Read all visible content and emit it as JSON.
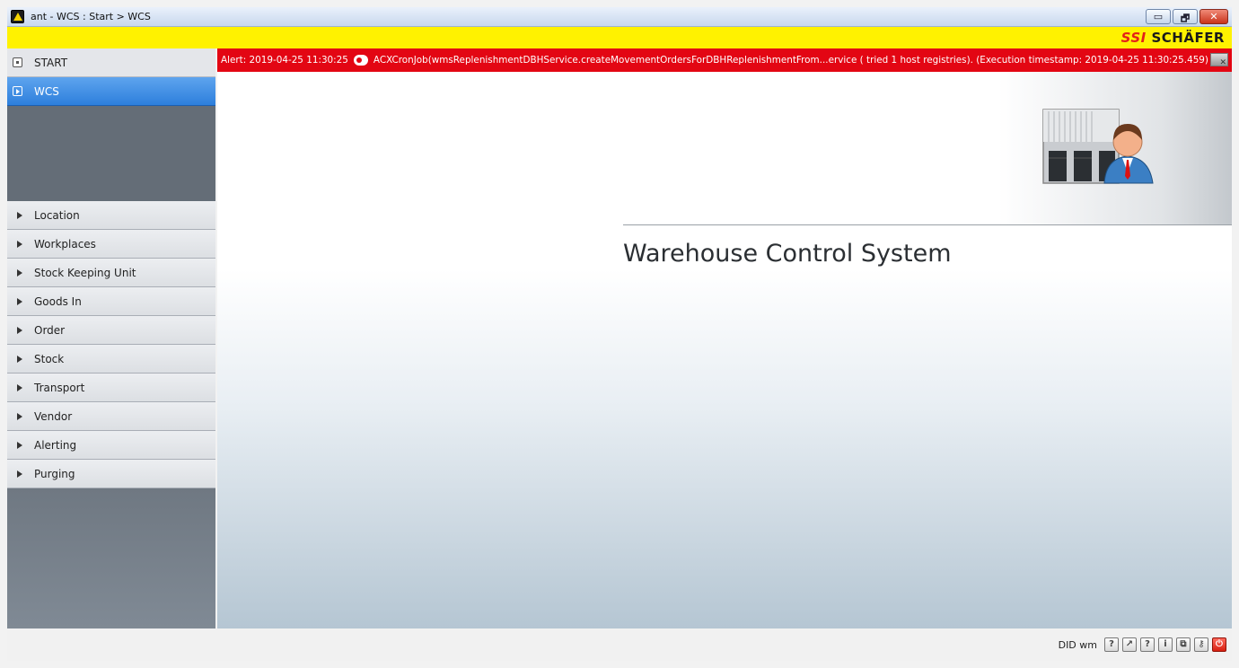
{
  "window": {
    "title": "ant - WCS : Start > WCS",
    "buttons": {
      "minimize": "▭",
      "restore": "🗗",
      "close": "✕"
    }
  },
  "brand": {
    "part1": "SSI",
    "part2": "SCHÄFER",
    "color_red": "#e32119",
    "color_yellow": "#fff200"
  },
  "sidebar": {
    "top": [
      {
        "label": "START",
        "icon": "square-dot-icon",
        "active": false
      },
      {
        "label": "WCS",
        "icon": "play-box-icon",
        "active": true
      }
    ],
    "items": [
      {
        "label": "Location"
      },
      {
        "label": "Workplaces"
      },
      {
        "label": "Stock Keeping Unit"
      },
      {
        "label": "Goods In"
      },
      {
        "label": "Order"
      },
      {
        "label": "Stock"
      },
      {
        "label": "Transport"
      },
      {
        "label": "Vendor"
      },
      {
        "label": "Alerting"
      },
      {
        "label": "Purging"
      }
    ]
  },
  "alert": {
    "prefix": "Alert: 2019-04-25 11:30:25",
    "message": "ACXCronJob(wmsReplenishmentDBHService.createMovementOrdersForDBHReplenishmentFrom...ervice ( tried 1 host registries). (Execution timestamp: 2019-04-25 11:30:25.459)",
    "color": "#e30613"
  },
  "main": {
    "heading": "Warehouse Control System"
  },
  "status": {
    "text": "DID wm",
    "tools": [
      {
        "icon": "help-icon",
        "glyph": "?"
      },
      {
        "icon": "external-window-icon",
        "glyph": "↗"
      },
      {
        "icon": "help-icon-2",
        "glyph": "?"
      },
      {
        "icon": "info-icon",
        "glyph": "i"
      },
      {
        "icon": "windows-icon",
        "glyph": "⧉"
      },
      {
        "icon": "key-icon",
        "glyph": "⚷"
      },
      {
        "icon": "power-icon",
        "glyph": "⏻"
      }
    ]
  }
}
